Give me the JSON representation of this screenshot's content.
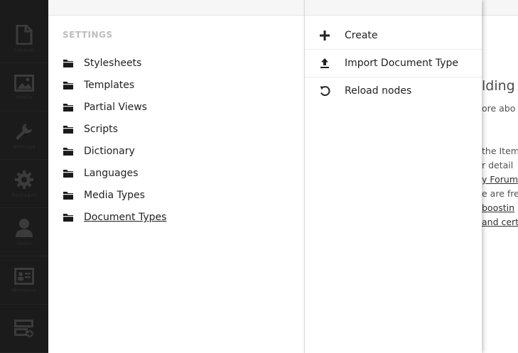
{
  "sections": [
    {
      "icon": "document-icon",
      "label": "Content"
    },
    {
      "icon": "image-icon",
      "label": "Media"
    },
    {
      "icon": "wrench-icon",
      "label": "Settings"
    },
    {
      "icon": "gear-icon",
      "label": "Packages"
    },
    {
      "icon": "user-icon",
      "label": "Users"
    },
    {
      "icon": "member-card-icon",
      "label": "Members"
    },
    {
      "icon": "forms-icon",
      "label": "Forms"
    }
  ],
  "tree": {
    "root_label": "SETTINGS",
    "items": [
      {
        "label": "Stylesheets"
      },
      {
        "label": "Templates"
      },
      {
        "label": "Partial Views"
      },
      {
        "label": "Scripts"
      },
      {
        "label": "Dictionary"
      },
      {
        "label": "Languages"
      },
      {
        "label": "Media Types"
      },
      {
        "label": "Document Types"
      }
    ]
  },
  "actions": [
    {
      "label": "Create",
      "icon": "plus-icon"
    },
    {
      "label": "Import Document Type",
      "icon": "upload-icon"
    },
    {
      "label": "Reload nodes",
      "icon": "reload-icon"
    }
  ],
  "background_content": {
    "heading": "lding b",
    "lines": [
      "ore abo",
      "the Item",
      "r detail",
      "y Forum",
      "e are fre",
      "boostin",
      "and cert"
    ]
  },
  "colors": {
    "sections_bg": "#1b1b1b",
    "icon_color": "#3a3a3a",
    "text": "#222222",
    "root_label": "#bdbdbd"
  }
}
